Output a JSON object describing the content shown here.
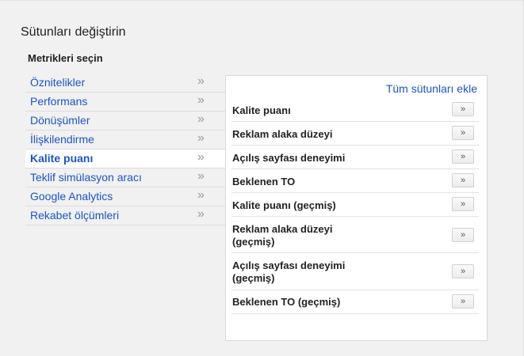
{
  "header": {
    "title": "Sütunları değiştirin",
    "section_title": "Metrikleri seçin"
  },
  "sidebar": {
    "items": [
      {
        "label": "Öznitelikler",
        "active": false
      },
      {
        "label": "Performans",
        "active": false
      },
      {
        "label": "Dönüşümler",
        "active": false
      },
      {
        "label": "İlişkilendirme",
        "active": false
      },
      {
        "label": "Kalite puanı",
        "active": true
      },
      {
        "label": "Teklif simülasyon aracı",
        "active": false
      },
      {
        "label": "Google Analytics",
        "active": false
      },
      {
        "label": "Rekabet ölçümleri",
        "active": false
      }
    ],
    "chevron": "»"
  },
  "panel": {
    "add_all_label": "Tüm sütunları ekle",
    "add_button_glyph": "»",
    "metrics": [
      {
        "label": "Kalite puanı"
      },
      {
        "label": "Reklam alaka düzeyi"
      },
      {
        "label": "Açılış sayfası deneyimi"
      },
      {
        "label": "Beklenen TO"
      },
      {
        "label": "Kalite puanı (geçmiş)"
      },
      {
        "label": "Reklam alaka düzeyi\n(geçmiş)"
      },
      {
        "label": "Açılış sayfası deneyimi\n(geçmiş)"
      },
      {
        "label": "Beklenen TO (geçmiş)"
      }
    ]
  },
  "colors": {
    "link": "#1a55c9",
    "background": "#f1f1f1",
    "panel": "#ffffff"
  }
}
